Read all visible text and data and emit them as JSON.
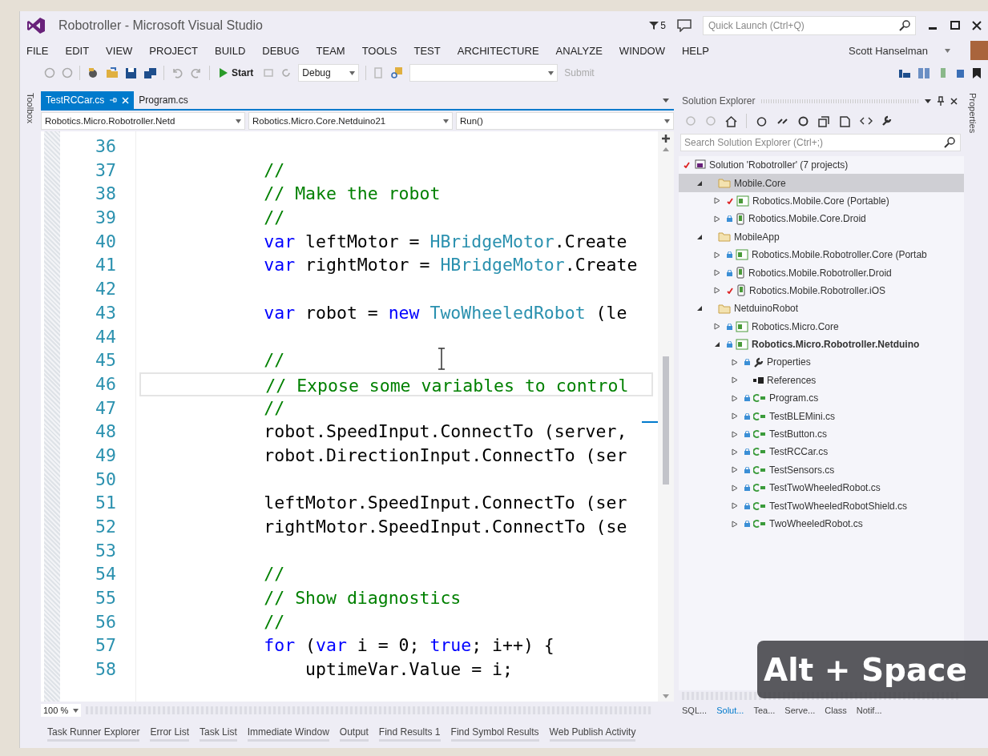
{
  "window": {
    "title": "Robotroller - Microsoft Visual Studio",
    "notification_count": "5",
    "quick_launch": {
      "placeholder": "Quick Launch (Ctrl+Q)"
    }
  },
  "menu": [
    "FILE",
    "EDIT",
    "VIEW",
    "PROJECT",
    "BUILD",
    "DEBUG",
    "TEAM",
    "TOOLS",
    "TEST",
    "ARCHITECTURE",
    "ANALYZE",
    "WINDOW",
    "HELP"
  ],
  "user": {
    "name": "Scott Hanselman"
  },
  "toolbar": {
    "start": "Start",
    "configuration": "Debug",
    "submit": "Submit"
  },
  "side_tabs": {
    "left": "Toolbox",
    "right": "Properties"
  },
  "editor": {
    "tabs": [
      {
        "label": "TestRCCar.cs",
        "selected": true
      },
      {
        "label": "Program.cs",
        "selected": false
      }
    ],
    "nav": [
      "Robotics.Micro.Robotroller.Netd",
      "Robotics.Micro.Core.Netduino21",
      "Run()"
    ],
    "lines": [
      {
        "number": "36",
        "current": false
      },
      {
        "number": "37",
        "kind": "body",
        "current": false,
        "tokens": [
          {
            "kind": "comment",
            "text": "//"
          }
        ]
      },
      {
        "number": "38",
        "kind": "body",
        "current": false,
        "tokens": [
          {
            "kind": "comment",
            "text": "// Make the robot"
          }
        ]
      },
      {
        "number": "39",
        "kind": "body",
        "current": false,
        "tokens": [
          {
            "kind": "comment",
            "text": "//"
          }
        ]
      },
      {
        "number": "40",
        "kind": "body",
        "current": false,
        "tokens": [
          {
            "kind": "kw",
            "text": "var "
          },
          {
            "kind": "plain",
            "text": "leftMotor = "
          },
          {
            "kind": "type",
            "text": "HBridgeMotor"
          },
          {
            "kind": "plain",
            "text": ".Create"
          }
        ]
      },
      {
        "number": "41",
        "kind": "body",
        "current": false,
        "tokens": [
          {
            "kind": "kw",
            "text": "var "
          },
          {
            "kind": "plain",
            "text": "rightMotor = "
          },
          {
            "kind": "type",
            "text": "HBridgeMotor"
          },
          {
            "kind": "plain",
            "text": ".Create"
          }
        ]
      },
      {
        "number": "42",
        "current": false
      },
      {
        "number": "43",
        "kind": "body",
        "current": false,
        "tokens": [
          {
            "kind": "kw",
            "text": "var "
          },
          {
            "kind": "plain",
            "text": "robot = "
          },
          {
            "kind": "kw",
            "text": "new "
          },
          {
            "kind": "type",
            "text": "TwoWheeledRobot"
          },
          {
            "kind": "plain",
            "text": " (le"
          }
        ]
      },
      {
        "number": "44",
        "current": false
      },
      {
        "number": "45",
        "kind": "body",
        "current": false,
        "tokens": [
          {
            "kind": "comment",
            "text": "//"
          }
        ]
      },
      {
        "number": "46",
        "kind": "body",
        "current": true,
        "tokens": [
          {
            "kind": "comment",
            "text": "// Expose some variables to control"
          }
        ]
      },
      {
        "number": "47",
        "kind": "body",
        "current": false,
        "tokens": [
          {
            "kind": "comment",
            "text": "//"
          }
        ]
      },
      {
        "number": "48",
        "kind": "body",
        "current": false,
        "tokens": [
          {
            "kind": "plain",
            "text": "robot.SpeedInput.ConnectTo (server,"
          }
        ]
      },
      {
        "number": "49",
        "kind": "body",
        "current": false,
        "tokens": [
          {
            "kind": "plain",
            "text": "robot.DirectionInput.ConnectTo (ser"
          }
        ]
      },
      {
        "number": "50",
        "current": false
      },
      {
        "number": "51",
        "kind": "body",
        "current": false,
        "tokens": [
          {
            "kind": "plain",
            "text": "leftMotor.SpeedInput.ConnectTo (ser"
          }
        ]
      },
      {
        "number": "52",
        "kind": "body",
        "current": false,
        "tokens": [
          {
            "kind": "plain",
            "text": "rightMotor.SpeedInput.ConnectTo (se"
          }
        ]
      },
      {
        "number": "53",
        "current": false
      },
      {
        "number": "54",
        "kind": "body",
        "current": false,
        "tokens": [
          {
            "kind": "comment",
            "text": "//"
          }
        ]
      },
      {
        "number": "55",
        "kind": "body",
        "current": false,
        "tokens": [
          {
            "kind": "comment",
            "text": "// Show diagnostics"
          }
        ]
      },
      {
        "number": "56",
        "kind": "body",
        "current": false,
        "tokens": [
          {
            "kind": "comment",
            "text": "//"
          }
        ]
      },
      {
        "number": "57",
        "kind": "body",
        "current": false,
        "tokens": [
          {
            "kind": "kw",
            "text": "for "
          },
          {
            "kind": "plain",
            "text": "("
          },
          {
            "kind": "kw",
            "text": "var "
          },
          {
            "kind": "plain",
            "text": "i = 0; "
          },
          {
            "kind": "kw",
            "text": "true"
          },
          {
            "kind": "plain",
            "text": "; i++) {"
          }
        ]
      },
      {
        "number": "58",
        "kind": "nested",
        "current": false,
        "tokens": [
          {
            "kind": "plain",
            "text": "uptimeVar.Value = i;"
          }
        ]
      }
    ],
    "zoom": "100 %"
  },
  "solution_explorer": {
    "title": "Solution Explorer",
    "search": {
      "placeholder": "Search Solution Explorer (Ctrl+;)"
    },
    "tree": [
      {
        "label": "Solution 'Robotroller' (7 projects)",
        "kind": "solution",
        "checked_out": true,
        "selected": false,
        "startup": false,
        "children": [
          {
            "label": "Mobile.Core",
            "kind": "folder",
            "expanded": true,
            "selected": true,
            "startup": false,
            "children": [
              {
                "label": "Robotics.Mobile.Core (Portable)",
                "kind": "project",
                "checked_out": true,
                "expanded": false,
                "selected": false,
                "startup": false
              },
              {
                "label": "Robotics.Mobile.Core.Droid",
                "kind": "phone-project",
                "checked_out": false,
                "expanded": false,
                "selected": false,
                "startup": false
              }
            ]
          },
          {
            "label": "MobileApp",
            "kind": "folder",
            "expanded": true,
            "selected": false,
            "startup": false,
            "children": [
              {
                "label": "Robotics.Mobile.Robotroller.Core (Portab",
                "kind": "project",
                "checked_out": false,
                "expanded": false,
                "selected": false,
                "startup": false
              },
              {
                "label": "Robotics.Mobile.Robotroller.Droid",
                "kind": "phone-project",
                "checked_out": false,
                "expanded": false,
                "selected": false,
                "startup": false
              },
              {
                "label": "Robotics.Mobile.Robotroller.iOS",
                "kind": "phone-project",
                "checked_out": true,
                "expanded": false,
                "selected": false,
                "startup": false
              }
            ]
          },
          {
            "label": "NetduinoRobot",
            "kind": "folder",
            "expanded": true,
            "selected": false,
            "startup": false,
            "children": [
              {
                "label": "Robotics.Micro.Core",
                "kind": "project",
                "checked_out": false,
                "expanded": false,
                "selected": false,
                "startup": false
              },
              {
                "label": "Robotics.Micro.Robotroller.Netduino",
                "kind": "project",
                "checked_out": false,
                "expanded": true,
                "selected": false,
                "startup": true,
                "children": [
                  {
                    "label": "Properties",
                    "kind": "properties",
                    "checked_out": false,
                    "expanded": false,
                    "selected": false,
                    "startup": false
                  },
                  {
                    "label": "References",
                    "kind": "references",
                    "expanded": false,
                    "selected": false,
                    "startup": false
                  },
                  {
                    "label": "Program.cs",
                    "kind": "file",
                    "checked_out": false,
                    "expanded": false,
                    "selected": false,
                    "startup": false
                  },
                  {
                    "label": "TestBLEMini.cs",
                    "kind": "file",
                    "checked_out": false,
                    "expanded": false,
                    "selected": false,
                    "startup": false
                  },
                  {
                    "label": "TestButton.cs",
                    "kind": "file",
                    "checked_out": false,
                    "expanded": false,
                    "selected": false,
                    "startup": false
                  },
                  {
                    "label": "TestRCCar.cs",
                    "kind": "file",
                    "checked_out": false,
                    "expanded": false,
                    "selected": false,
                    "startup": false
                  },
                  {
                    "label": "TestSensors.cs",
                    "kind": "file",
                    "checked_out": false,
                    "expanded": false,
                    "selected": false,
                    "startup": false
                  },
                  {
                    "label": "TestTwoWheeledRobot.cs",
                    "kind": "file",
                    "checked_out": false,
                    "expanded": false,
                    "selected": false,
                    "startup": false
                  },
                  {
                    "label": "TestTwoWheeledRobotShield.cs",
                    "kind": "file",
                    "checked_out": false,
                    "expanded": false,
                    "selected": false,
                    "startup": false
                  },
                  {
                    "label": "TwoWheeledRobot.cs",
                    "kind": "file",
                    "checked_out": false,
                    "expanded": false,
                    "selected": false,
                    "startup": false
                  }
                ]
              }
            ]
          }
        ]
      }
    ],
    "tabs": [
      {
        "label": "SQL...",
        "selected": false
      },
      {
        "label": "Solut...",
        "selected": true
      },
      {
        "label": "Tea...",
        "selected": false
      },
      {
        "label": "Serve...",
        "selected": false
      },
      {
        "label": "Class",
        "selected": false
      },
      {
        "label": "Notif...",
        "selected": false
      }
    ]
  },
  "bottom_tabs": [
    "Task Runner Explorer",
    "Error List",
    "Task List",
    "Immediate Window",
    "Output",
    "Find Results 1",
    "Find Symbol Results",
    "Web Publish Activity"
  ],
  "keystroke_overlay": {
    "text": "Alt + Space"
  }
}
